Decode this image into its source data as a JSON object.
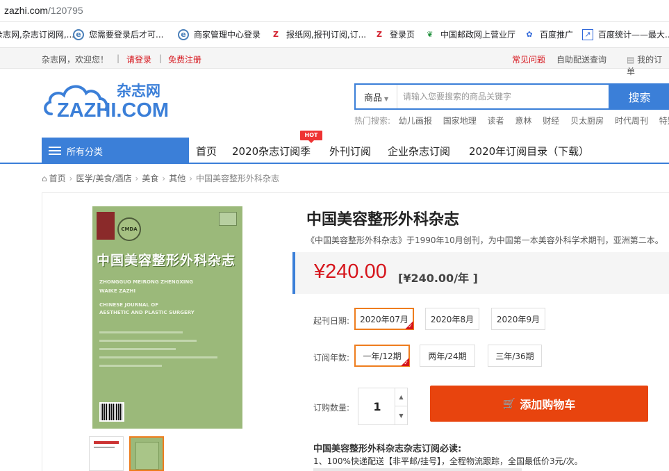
{
  "browser": {
    "url_host": "zazhi.com",
    "url_path": "/120795"
  },
  "bookmarks": [
    {
      "label": "杂志网,杂志订阅网,...",
      "icon": "ie-icon"
    },
    {
      "label": "您需要登录后才可...",
      "icon": "ie-icon"
    },
    {
      "label": "商家管理中心登录",
      "icon": "ie-icon"
    },
    {
      "label": "报纸网,报刊订阅,订...",
      "icon": "z-logo-icon"
    },
    {
      "label": "登录页",
      "icon": "z-logo-icon"
    },
    {
      "label": "中国邮政网上营业厅",
      "icon": "leaf-icon"
    },
    {
      "label": "百度推广",
      "icon": "paw-icon"
    },
    {
      "label": "百度统计——最大...",
      "icon": "chart-icon"
    }
  ],
  "topbar": {
    "welcome": "杂志网，欢迎您！",
    "login": "请登录",
    "register": "免费注册",
    "faq": "常见问题",
    "query": "自助配送查询",
    "orders": "我的订单",
    "separator": "|"
  },
  "logo": {
    "cn": "杂志网",
    "en": "ZAZHI.COM"
  },
  "search": {
    "category": "商品",
    "placeholder": "请输入您要搜索的商品关键字",
    "button": "搜索"
  },
  "hot_search": {
    "label": "热门搜索:",
    "items": [
      "幼儿画报",
      "国家地理",
      "读者",
      "意林",
      "财经",
      "贝太厨房",
      "时代周刊",
      "特别关注"
    ]
  },
  "nav": {
    "all_categories": "所有分类",
    "items": [
      "首页",
      "2020杂志订阅季",
      "外刊订阅",
      "企业杂志订阅",
      "2020年订阅目录（下载）"
    ],
    "hot_badge": "HOT"
  },
  "breadcrumb": [
    "首页",
    "医学/美食/酒店",
    "美食",
    "其他",
    "中国美容整形外科杂志"
  ],
  "cover": {
    "title_cn": "中国美容整形外科杂志",
    "pinyin_1": "ZHONGGUO MEIRONG ZHENGXING",
    "pinyin_2": "WAIKE ZAZHI",
    "en_1": "CHINESE JOURNAL OF",
    "en_2": "AESTHETIC AND PLASTIC SURGERY",
    "seal": "CMDA"
  },
  "product": {
    "title": "中国美容整形外科杂志",
    "description": "《中国美容整形外科杂志》于1990年10月创刊，为中国第一本美容外科学术期刊，亚洲第二本。",
    "price": "¥240.00",
    "price_sub": "[¥240.00/年 ]"
  },
  "options": {
    "start_label": "起刊日期:",
    "start_dates": [
      "2020年07月",
      "2020年8月",
      "2020年9月"
    ],
    "start_selected": 0,
    "period_label": "订阅年数:",
    "periods": [
      "一年/12期",
      "两年/24期",
      "三年/36期"
    ],
    "period_selected": 0,
    "qty_label": "订购数量:",
    "qty": "1"
  },
  "cart_button": "添加购物车",
  "notice": {
    "title": "中国美容整形外科杂志杂志订阅必读:",
    "line1": "1、100%快递配送【非平邮/挂号】，全程物流跟踪，全国最低价3元/次。"
  },
  "colors": {
    "brand_blue": "#3b7fd8",
    "price_red": "#d6151c",
    "cart_orange": "#e8440e",
    "select_orange": "#ee7d1e",
    "cover_green": "#9bb97a"
  }
}
